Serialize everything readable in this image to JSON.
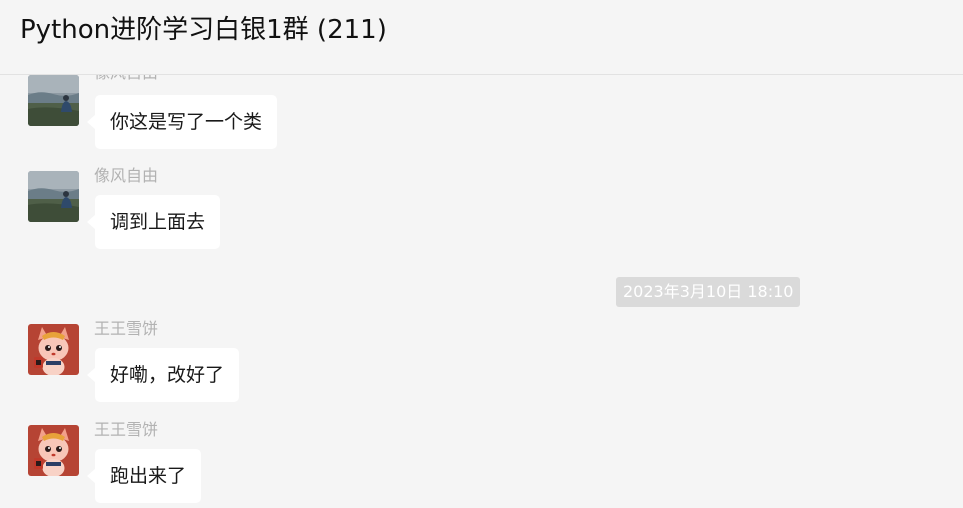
{
  "chat": {
    "title": "Python进阶学习白银1群 (211)"
  },
  "timestamp": "2023年3月10日 18:10",
  "messages": [
    {
      "sender": "像风自由",
      "text": "你这是写了一个类",
      "avatar": "landscape-avatar"
    },
    {
      "sender": "像风自由",
      "text": "调到上面去",
      "avatar": "landscape-avatar"
    },
    {
      "sender": "王王雪饼",
      "text": "好嘞，改好了",
      "avatar": "cartoon-fox-avatar"
    },
    {
      "sender": "王王雪饼",
      "text": "跑出来了",
      "avatar": "cartoon-fox-avatar"
    }
  ],
  "colors": {
    "background": "#f5f5f5",
    "bubble": "#ffffff",
    "sender": "#b2b2b2",
    "timestamp_bg": "#dadada"
  }
}
